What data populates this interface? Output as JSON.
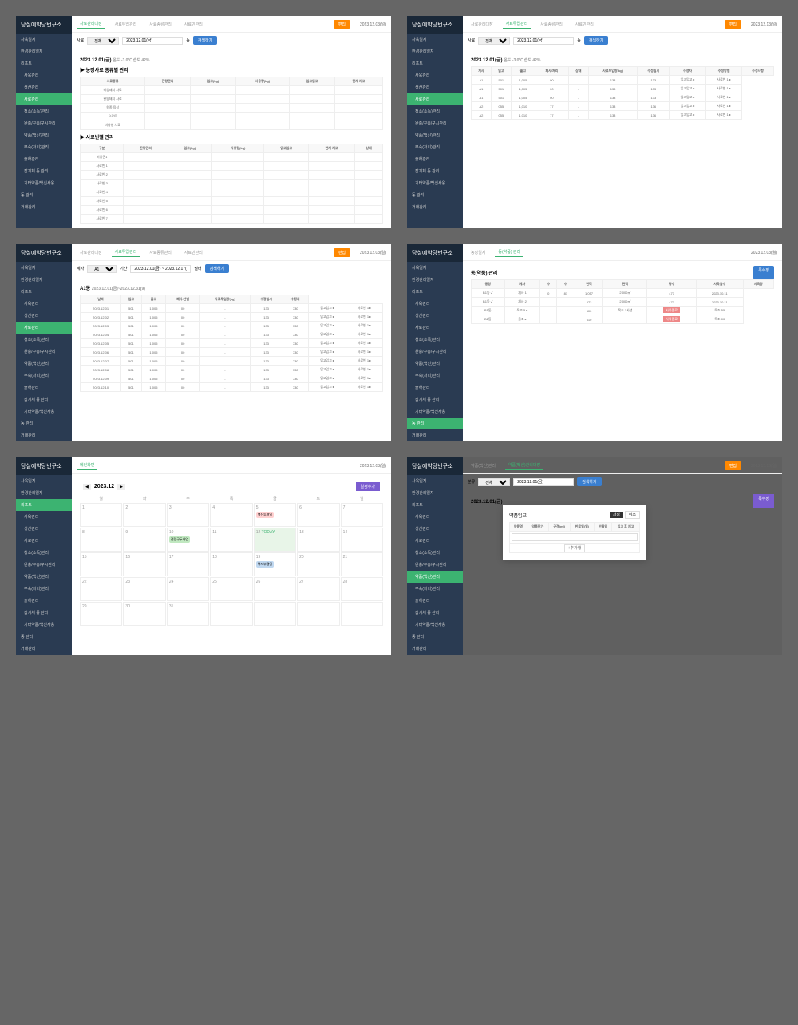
{
  "logo": "당실예약당번구소",
  "dates": {
    "a": "2023.12.03(일)",
    "b": "2023.12.13(일)",
    "c": "2023.12.03(월)"
  },
  "nav": {
    "items": [
      "사육일지",
      "환경관리일지",
      "리포트",
      "사육관리",
      "생산관리",
      "사료관리",
      "청소(소독)관리",
      "완충/구충/구시관리",
      "약품(백신)관리",
      "부숙(처리)관리",
      "출하관리",
      "잡기체 등 관리",
      "기타약품/백신사용",
      "동 관리",
      "거래관리"
    ]
  },
  "tabsA": [
    "사료관리대장",
    "사료투입관리",
    "사료종류관리",
    "사료빈관리"
  ],
  "tabsB": [
    "농장일지",
    "동(약품) 관리"
  ],
  "tabsC": [
    "약품(백신)관리",
    "약품(백신)관리대장"
  ],
  "tabD": "메인화면",
  "filter": {
    "name": "사료",
    "range": "전체",
    "date": "2023.12.01(금)",
    "dong": "동",
    "search": "검색하기"
  },
  "p1": {
    "date": "2023.12.01(금)",
    "meta": "온도 -3.0℃ 습도 42%",
    "sec1": "▶ 농장사료 종류별 관리",
    "sec2": "▶ 사료빈별 관리",
    "h1": [
      "사료종류",
      "잔량관리",
      "입고(kg)",
      "사용량(kg)",
      "입고입고",
      "현재 재고"
    ],
    "r1": [
      "비앙돼지 사료",
      "완동돼지 사료",
      "원종 육성",
      "으르트",
      "비앙청 사료"
    ],
    "h2": [
      "구분",
      "잔량관리",
      "입고(kg)",
      "사용량(kg)",
      "입고입고",
      "현재 재고",
      "상태"
    ],
    "r2": [
      "비앙돈1",
      "사료빈 1",
      "사료빈 2",
      "사료빈 3",
      "사료빈 4",
      "사료빈 5",
      "사료빈 6",
      "사료빈 7"
    ]
  },
  "p2": {
    "title": "A1동",
    "range": "2023.12.01(금)~2023.12.31(9)",
    "h": [
      "날짜",
      "입고",
      "출고",
      "폐사/선별",
      "사료투입량(kg)",
      "수정일시",
      "수정자"
    ],
    "rows": [
      [
        "2023.12.01",
        "501",
        "1,005",
        "00",
        "-",
        "133",
        "730",
        "입고입고 ▸",
        "사료빈 1 ▸"
      ],
      [
        "2023.12.02",
        "501",
        "1,005",
        "00",
        "-",
        "133",
        "730",
        "입고입고 ▸",
        "사료빈 1 ▸"
      ],
      [
        "2023.12.03",
        "501",
        "1,005",
        "00",
        "-",
        "133",
        "730",
        "입고입고 ▸",
        "사료빈 1 ▸"
      ],
      [
        "2023.12.04",
        "501",
        "1,005",
        "00",
        "-",
        "133",
        "730",
        "입고입고 ▸",
        "사료빈 1 ▸"
      ],
      [
        "2023.12.05",
        "501",
        "1,005",
        "00",
        "-",
        "133",
        "730",
        "입고입고 ▸",
        "사료빈 1 ▸"
      ],
      [
        "2023.12.06",
        "501",
        "1,005",
        "00",
        "-",
        "133",
        "730",
        "입고입고 ▸",
        "사료빈 1 ▸"
      ],
      [
        "2023.12.07",
        "501",
        "1,005",
        "00",
        "-",
        "133",
        "730",
        "입고입고 ▸",
        "사료빈 1 ▸"
      ],
      [
        "2023.12.08",
        "501",
        "1,005",
        "00",
        "-",
        "133",
        "730",
        "입고입고 ▸",
        "사료빈 1 ▸"
      ],
      [
        "2023.12.09",
        "501",
        "1,005",
        "00",
        "-",
        "133",
        "730",
        "입고입고 ▸",
        "사료빈 1 ▸"
      ],
      [
        "2023.12.10",
        "501",
        "1,005",
        "00",
        "-",
        "133",
        "730",
        "입고입고 ▸",
        "사료빈 1 ▸"
      ]
    ]
  },
  "p3": {
    "month": "2023.12",
    "add": "일정추가",
    "days": [
      "월",
      "화",
      "수",
      "목",
      "금",
      "토",
      "일"
    ],
    "today": "TODAY",
    "ev1": "백신투여일",
    "ev2": "전량구두사업",
    "ev3": "복지부평일"
  },
  "p4": {
    "date": "2023.12.01(금)",
    "meta": "온도 -3.0℃ 습도 42%",
    "h": [
      "계사",
      "입고",
      "출고",
      "폐사/처리",
      "상태",
      "사료투입량(kg)",
      "수정일시",
      "수정자",
      "수정방법",
      "수정사항"
    ],
    "rows": [
      [
        "A1",
        "501",
        "1,005",
        "00",
        "-",
        "133",
        "133",
        "입고입고 ▸",
        "사료빈 1 ▸"
      ],
      [
        "A1",
        "501",
        "1,005",
        "00",
        "-",
        "133",
        "133",
        "입고입고 ▸",
        "사료빈 1 ▸"
      ],
      [
        "A1",
        "501",
        "1,005",
        "00",
        "-",
        "133",
        "133",
        "입고입고 ▸",
        "사료빈 1 ▸"
      ],
      [
        "A2",
        "055",
        "1,010",
        "77",
        "-",
        "133",
        "136",
        "입고입고 ▸",
        "사료빈 1 ▸"
      ],
      [
        "A2",
        "055",
        "1,010",
        "77",
        "-",
        "133",
        "136",
        "입고입고 ▸",
        "사료빈 1 ▸"
      ]
    ]
  },
  "p5": {
    "title": "동(약품) 관리",
    "add": "목수정",
    "h": [
      "동명",
      "계사",
      "수",
      "수",
      "면적",
      "면적",
      "평수",
      "사육일수",
      "사육량"
    ],
    "rows": [
      [
        "B1동 ✓",
        "계사 1",
        "0",
        "81",
        "1,057",
        "2,000㎡",
        "477",
        "2023.10.11"
      ],
      [
        "B1동 ✓",
        "계사 2",
        "",
        "",
        "572",
        "2,000㎡",
        "477",
        "2023.10.11"
      ],
      [
        "B1동",
        "목조 5 ▸",
        "",
        "",
        "600",
        "목조 1사년",
        "사육종료",
        "목조 55"
      ],
      [
        "B1동",
        "울조 ▸",
        "",
        "",
        "610",
        "",
        "사육종료",
        "목조 00"
      ]
    ],
    "btns": [
      "사육종료"
    ]
  },
  "p6": {
    "date": "2023.12.01(금)",
    "add": "목수정",
    "modal": {
      "title": "약품입고",
      "save": "저장",
      "cancel": "취소",
      "h": [
        "약품명",
        "약품단가",
        "규격(ml)",
        "만료일(일)",
        "만들일",
        "입고 후 재고"
      ],
      "addRow": "+추가행"
    }
  }
}
